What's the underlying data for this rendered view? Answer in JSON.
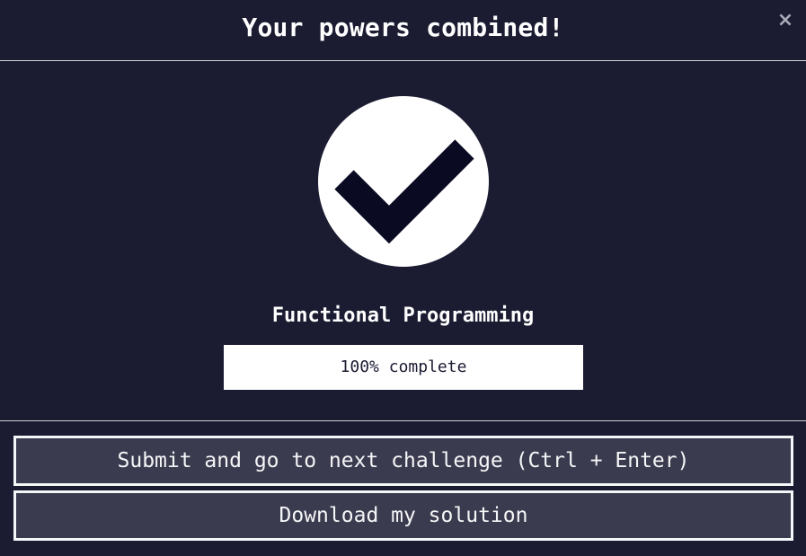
{
  "modal": {
    "title": "Your powers combined!",
    "close_symbol": "×"
  },
  "body": {
    "icon": "check-circle-icon",
    "certification_title": "Functional Programming",
    "progress": {
      "percent": 100,
      "label": "100% complete"
    }
  },
  "footer": {
    "submit_label": "Submit and go to next challenge (Ctrl + Enter)",
    "download_label": "Download my solution"
  },
  "colors": {
    "background": "#1b1b32",
    "button_bg": "#3b3b4f",
    "check_mark": "#0a0a23",
    "text": "#ffffff"
  }
}
